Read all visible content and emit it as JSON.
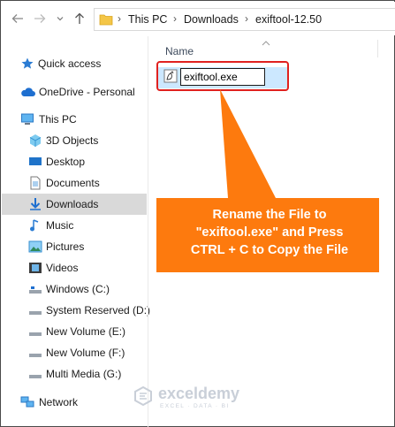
{
  "address_bar": {
    "crumbs": [
      "This PC",
      "Downloads",
      "exiftool-12.50"
    ]
  },
  "nav_pane": {
    "items": [
      {
        "label": "Quick access",
        "icon": "star-icon"
      },
      {
        "label": "OneDrive - Personal",
        "icon": "cloud-icon"
      },
      {
        "label": "This PC",
        "icon": "computer-icon"
      },
      {
        "label": "3D Objects",
        "icon": "cube-icon"
      },
      {
        "label": "Desktop",
        "icon": "desktop-icon"
      },
      {
        "label": "Documents",
        "icon": "document-icon"
      },
      {
        "label": "Downloads",
        "icon": "download-icon"
      },
      {
        "label": "Music",
        "icon": "music-icon"
      },
      {
        "label": "Pictures",
        "icon": "picture-icon"
      },
      {
        "label": "Videos",
        "icon": "video-icon"
      },
      {
        "label": "Windows (C:)",
        "icon": "drive-icon"
      },
      {
        "label": "System Reserved (D:)",
        "icon": "drive-icon"
      },
      {
        "label": "New Volume (E:)",
        "icon": "drive-icon"
      },
      {
        "label": "New Volume (F:)",
        "icon": "drive-icon"
      },
      {
        "label": "Multi Media (G:)",
        "icon": "drive-icon"
      },
      {
        "label": "Network",
        "icon": "network-icon"
      }
    ],
    "selected": "Downloads"
  },
  "content": {
    "column_header": "Name",
    "rename_value": "exiftool.exe"
  },
  "callout": {
    "line1": "Rename the File to",
    "line2": "\"exiftool.exe\" and Press",
    "line3": "CTRL + C to Copy the File",
    "color": "#fd7a0e"
  },
  "watermark": {
    "name": "exceldemy",
    "tagline": "EXCEL · DATA · BI"
  },
  "colors": {
    "highlight": "#e0211f",
    "selection": "#cce8ff",
    "nav_selected": "#d9d9d9"
  }
}
